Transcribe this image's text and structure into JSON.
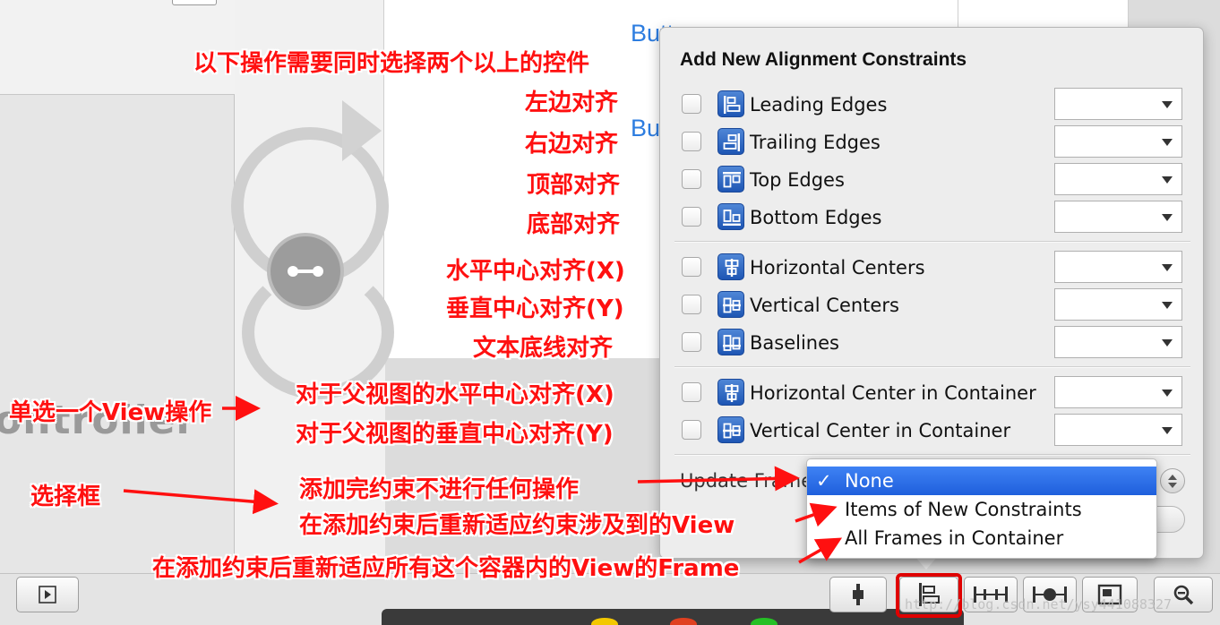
{
  "canvas": {
    "ghost_buttons": [
      "Button",
      "Button"
    ],
    "controller_text": "ontroller"
  },
  "popover": {
    "title": "Add New Alignment Constraints",
    "rows": [
      {
        "label": "Leading Edges",
        "icon": "leading-edges-icon",
        "checked": false
      },
      {
        "label": "Trailing Edges",
        "icon": "trailing-edges-icon",
        "checked": false
      },
      {
        "label": "Top Edges",
        "icon": "top-edges-icon",
        "checked": false
      },
      {
        "label": "Bottom Edges",
        "icon": "bottom-edges-icon",
        "checked": false
      },
      {
        "label": "Horizontal Centers",
        "icon": "horizontal-centers-icon",
        "checked": false
      },
      {
        "label": "Vertical Centers",
        "icon": "vertical-centers-icon",
        "checked": false
      },
      {
        "label": "Baselines",
        "icon": "baselines-icon",
        "checked": false
      },
      {
        "label": "Horizontal Center in Container",
        "icon": "horizontal-center-in-container-icon",
        "checked": false
      },
      {
        "label": "Vertical Center in Container",
        "icon": "vertical-center-in-container-icon",
        "checked": false
      }
    ],
    "update_frames_label": "Update Frames"
  },
  "update_frames_menu": {
    "options": [
      "None",
      "Items of New Constraints",
      "All Frames in Container"
    ],
    "selected": "None",
    "check_mark": "✓"
  },
  "toolbar": {
    "left_button_icon": "play-icon",
    "buttons": [
      "resolve-icon",
      "align-icon",
      "pin-icon",
      "resize-icon",
      "frame-icon",
      "zoom-icon"
    ],
    "watermark": "http://blog.csdn.net/ysy441088327"
  },
  "annotations": {
    "header": "以下操作需要同时选择两个以上的控件",
    "leading": "左边对齐",
    "trailing": "右边对齐",
    "top": "顶部对齐",
    "bottom": "底部对齐",
    "hcenter": "水平中心对齐(X)",
    "vcenter": "垂直中心对齐(Y)",
    "baseline": "文本底线对齐",
    "single_view": "单选一个View操作",
    "hcenter_container": "对于父视图的水平中心对齐(X)",
    "vcenter_container": "对于父视图的垂直中心对齐(Y)",
    "select_box": "选择框",
    "none_desc": "添加完约束不进行任何操作",
    "items_desc": "在添加约束后重新适应约束涉及到的View",
    "all_desc": "在添加约束后重新适应所有这个容器内的View的Frame"
  },
  "colors": {
    "annotation": "#ff1010",
    "selection": "#2f6fe8",
    "highlight_box": "#e00000",
    "ghost_button": "#2d7de0"
  }
}
